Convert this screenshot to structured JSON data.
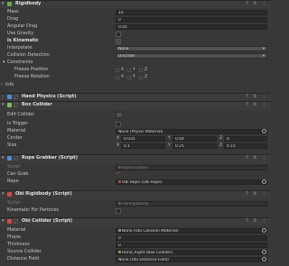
{
  "rigidbody": {
    "title": "Rigidbody",
    "mass_label": "Mass",
    "mass_value": "10",
    "drag_label": "Drag",
    "drag_value": "0",
    "angular_drag_label": "Angular Drag",
    "angular_drag_value": "0.05",
    "use_gravity_label": "Use Gravity",
    "is_kinematic_label": "Is Kinematic",
    "interpolate_label": "Interpolate",
    "interpolate_value": "None",
    "collision_detection_label": "Collision Detection",
    "collision_detection_value": "Discrete",
    "constraints_label": "Constraints",
    "freeze_position_label": "Freeze Position",
    "freeze_rotation_label": "Freeze Rotation",
    "axis_x": "X",
    "axis_y": "Y",
    "axis_z": "Z",
    "info_label": "Info"
  },
  "hand_physics": {
    "title": "Hand Physics (Script)"
  },
  "box_collider": {
    "title": "Box Collider",
    "edit_collider_label": "Edit Collider",
    "is_trigger_label": "Is Trigger",
    "material_label": "Material",
    "material_value": "None (Physic Material)",
    "center_label": "Center",
    "center_x": "0.035",
    "center_y": "0.04",
    "center_z": "0",
    "size_label": "Size",
    "size_x": "0.1",
    "size_y": "0.25",
    "size_z": "0.15",
    "x": "X",
    "y": "Y",
    "z": "Z"
  },
  "rope_grabber": {
    "title": "Rope Grabber (Script)",
    "script_label": "Script",
    "script_value": "RopeGrabber",
    "can_grab_label": "Can Grab",
    "rope_label": "Rope",
    "rope_value": "Obi Rope (Obi Rope)"
  },
  "obi_rigidbody": {
    "title": "Obi Rigidbody (Script)",
    "script_label": "Script",
    "script_value": "ObiRigidbody",
    "kinematic_label": "Kinematic For Particles"
  },
  "obi_collider": {
    "title": "Obi Collider (Script)",
    "material_label": "Material",
    "material_value": "None (Obi Collision Material)",
    "phase_label": "Phase",
    "phase_value": "0",
    "thickness_label": "Thickness",
    "thickness_value": "0",
    "source_label": "Source Collider",
    "source_value": "Hand_Right (Box Collider)",
    "distance_label": "Distance Field",
    "distance_value": "None (Obi Distance Field)"
  },
  "colors": {
    "bg": "#383838",
    "header": "#3c3c3c",
    "field": "#2a2a2a",
    "accent": "#5cb85c"
  }
}
